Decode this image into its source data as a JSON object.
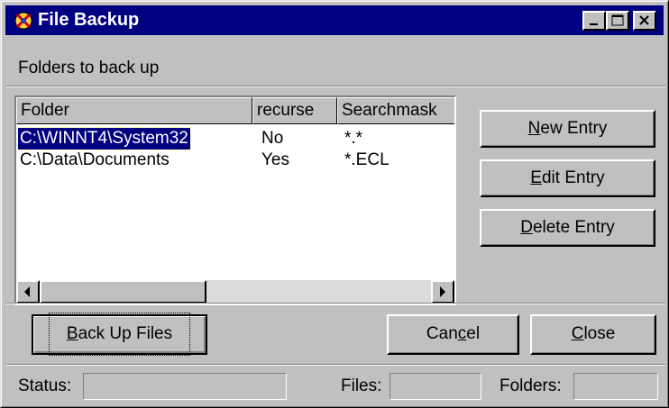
{
  "window": {
    "title": "File Backup",
    "colors": {
      "titlebar": "#000080",
      "face": "#c0c0c0",
      "selection": "#000080"
    }
  },
  "section_label": "Folders to back up",
  "list": {
    "columns": [
      "Folder",
      "recurse",
      "Searchmask"
    ],
    "rows": [
      {
        "folder": "C:\\WINNT4\\System32",
        "recurse": "No",
        "mask": "*.*",
        "selected": true
      },
      {
        "folder": "C:\\Data\\Documents",
        "recurse": "Yes",
        "mask": "*.ECL",
        "selected": false
      }
    ]
  },
  "buttons": {
    "new_entry": {
      "mnemonic": "N",
      "rest": "ew Entry"
    },
    "edit_entry": {
      "mnemonic": "E",
      "rest": "dit Entry"
    },
    "delete_entry": {
      "mnemonic": "D",
      "rest": "elete Entry"
    },
    "back_up": {
      "mnemonic": "B",
      "rest": "ack Up Files"
    },
    "cancel": {
      "pre": "Can",
      "mnemonic": "c",
      "rest": "el"
    },
    "close": {
      "mnemonic": "C",
      "rest": "lose"
    }
  },
  "status": {
    "status_label": "Status:",
    "files_label": "Files:",
    "folders_label": "Folders:"
  },
  "icons": [
    "app-icon",
    "minimize-icon",
    "maximize-icon",
    "close-icon",
    "scroll-left-icon",
    "scroll-right-icon"
  ]
}
